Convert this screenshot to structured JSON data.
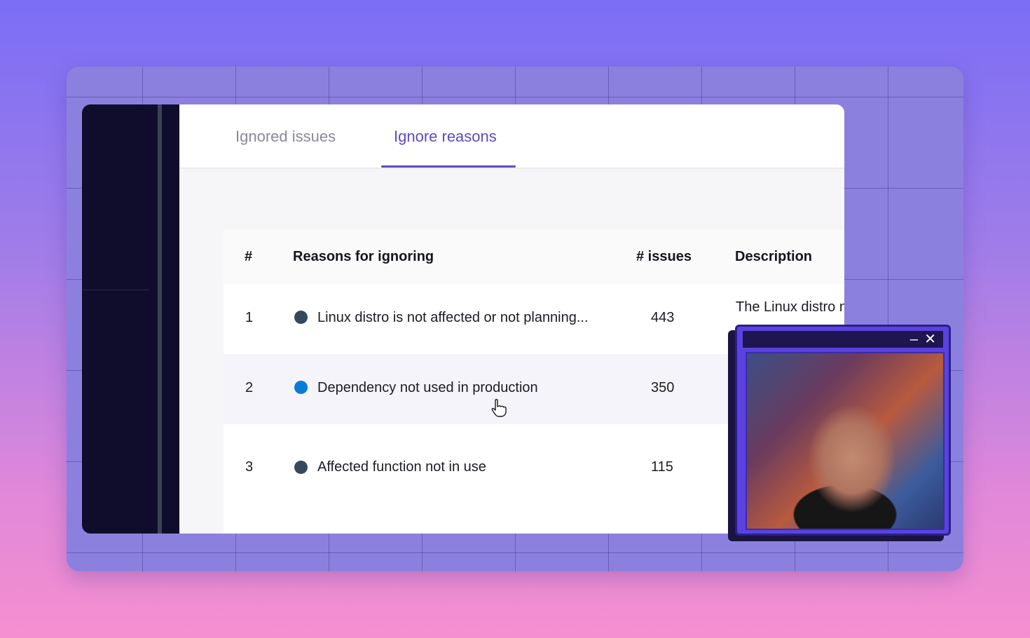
{
  "tabs": {
    "ignored_issues": "Ignored issues",
    "ignore_reasons": "Ignore reasons",
    "active": "Ignore reasons"
  },
  "table": {
    "headers": {
      "index": "#",
      "reason": "Reasons for ignoring",
      "issues": "# issues",
      "description": "Description"
    },
    "rows": [
      {
        "index": "1",
        "reason": "Linux distro is not affected or not planning...",
        "issues": "443",
        "description": "The Linux distro n",
        "dot_color": "#34495e"
      },
      {
        "index": "2",
        "reason": "Dependency not used in production",
        "issues": "350",
        "description": "",
        "dot_color": "#0a7ad8"
      },
      {
        "index": "3",
        "reason": "Affected function not in use",
        "issues": "115",
        "description": "",
        "dot_color": "#34495e"
      }
    ]
  },
  "pip": {
    "minimize_icon": "minimize-icon",
    "close_icon": "close-icon"
  },
  "colors": {
    "accent": "#5c4dbf",
    "sidebar": "#100d2c"
  }
}
